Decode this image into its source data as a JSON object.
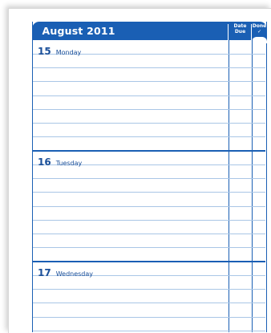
{
  "planner": {
    "month": "August 2011",
    "col_due": "Date\nDue",
    "col_done": "Done\n✓",
    "days": [
      {
        "num": "15",
        "name": "Monday"
      },
      {
        "num": "16",
        "name": "Tuesday"
      },
      {
        "num": "17",
        "name": "Wednesday"
      }
    ]
  },
  "colors": {
    "accent": "#1a5fb4",
    "rule": "#a9c6e6"
  }
}
